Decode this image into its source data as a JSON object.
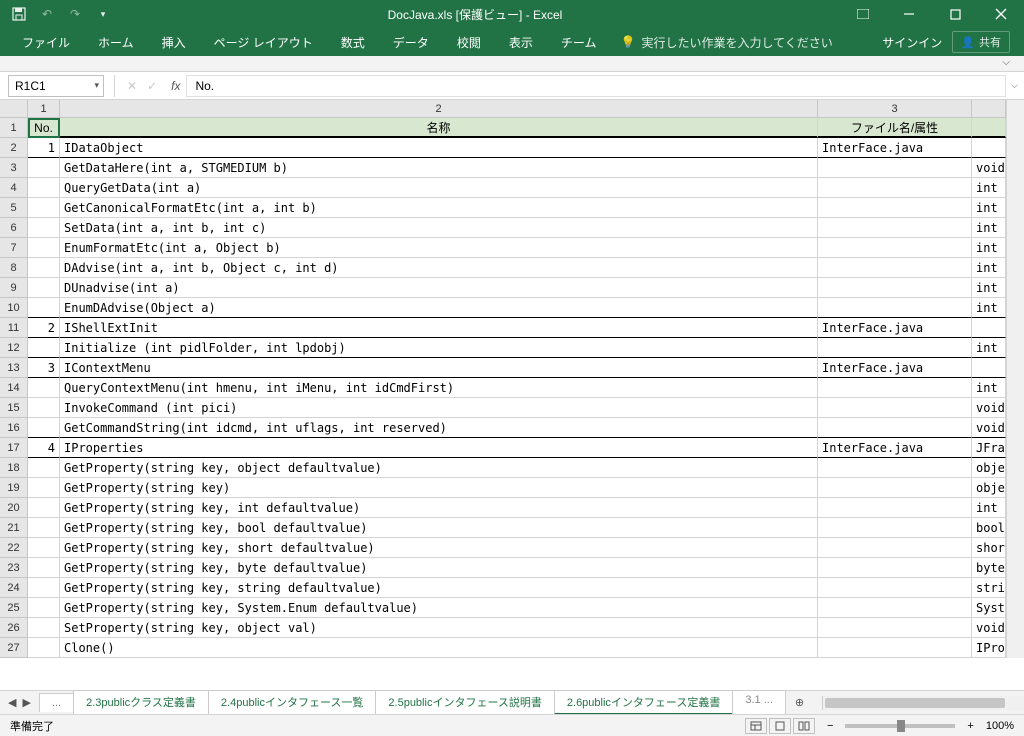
{
  "title": "DocJava.xls  [保護ビュー] - Excel",
  "qat": {
    "undo": "↶",
    "redo": "↷"
  },
  "ribbon": {
    "tabs": [
      "ファイル",
      "ホーム",
      "挿入",
      "ページ レイアウト",
      "数式",
      "データ",
      "校閲",
      "表示",
      "チーム"
    ],
    "tellme": "実行したい作業を入力してください",
    "signin": "サインイン",
    "share": "共有"
  },
  "namebox": "R1C1",
  "formula": "No.",
  "columns": [
    "1",
    "2",
    "3",
    ""
  ],
  "headers": {
    "no": "No.",
    "name": "名称",
    "file": "ファイル名/属性"
  },
  "rows": [
    {
      "r": 2,
      "no": "1",
      "name": "IDataObject",
      "file": "InterFace.java",
      "ret": "",
      "b": true
    },
    {
      "r": 3,
      "no": "",
      "name": "GetDataHere(int a, STGMEDIUM b)",
      "file": "",
      "ret": "void"
    },
    {
      "r": 4,
      "no": "",
      "name": "QueryGetData(int a)",
      "file": "",
      "ret": "int"
    },
    {
      "r": 5,
      "no": "",
      "name": "GetCanonicalFormatEtc(int a, int b)",
      "file": "",
      "ret": "int"
    },
    {
      "r": 6,
      "no": "",
      "name": "SetData(int a, int b, int c)",
      "file": "",
      "ret": "int"
    },
    {
      "r": 7,
      "no": "",
      "name": "EnumFormatEtc(int a, Object b)",
      "file": "",
      "ret": "int"
    },
    {
      "r": 8,
      "no": "",
      "name": "DAdvise(int a, int b, Object c, int d)",
      "file": "",
      "ret": "int"
    },
    {
      "r": 9,
      "no": "",
      "name": "DUnadvise(int a)",
      "file": "",
      "ret": "int"
    },
    {
      "r": 10,
      "no": "",
      "name": "EnumDAdvise(Object a)",
      "file": "",
      "ret": "int",
      "b": true
    },
    {
      "r": 11,
      "no": "2",
      "name": "IShellExtInit",
      "file": "InterFace.java",
      "ret": "",
      "b": true
    },
    {
      "r": 12,
      "no": "",
      "name": "Initialize (int pidlFolder, int lpdobj)",
      "file": "",
      "ret": "int",
      "b": true
    },
    {
      "r": 13,
      "no": "3",
      "name": "IContextMenu",
      "file": "InterFace.java",
      "ret": "",
      "b": true
    },
    {
      "r": 14,
      "no": "",
      "name": "QueryContextMenu(int hmenu, int iMenu, int idCmdFirst)",
      "file": "",
      "ret": "int"
    },
    {
      "r": 15,
      "no": "",
      "name": "InvokeCommand (int pici)",
      "file": "",
      "ret": "void"
    },
    {
      "r": 16,
      "no": "",
      "name": "GetCommandString(int idcmd, int uflags, int reserved)",
      "file": "",
      "ret": "void",
      "b": true
    },
    {
      "r": 17,
      "no": "4",
      "name": "IProperties",
      "file": "InterFace.java",
      "ret": "JFra",
      "b": true
    },
    {
      "r": 18,
      "no": "",
      "name": "GetProperty(string key, object defaultvalue)",
      "file": "",
      "ret": "obje"
    },
    {
      "r": 19,
      "no": "",
      "name": "GetProperty(string key)",
      "file": "",
      "ret": "obje"
    },
    {
      "r": 20,
      "no": "",
      "name": "GetProperty(string key, int defaultvalue)",
      "file": "",
      "ret": "int"
    },
    {
      "r": 21,
      "no": "",
      "name": "GetProperty(string key, bool defaultvalue)",
      "file": "",
      "ret": "bool"
    },
    {
      "r": 22,
      "no": "",
      "name": "GetProperty(string key, short defaultvalue)",
      "file": "",
      "ret": "shor"
    },
    {
      "r": 23,
      "no": "",
      "name": "GetProperty(string key, byte defaultvalue)",
      "file": "",
      "ret": "byte"
    },
    {
      "r": 24,
      "no": "",
      "name": "GetProperty(string key, string defaultvalue)",
      "file": "",
      "ret": "stri"
    },
    {
      "r": 25,
      "no": "",
      "name": "GetProperty(string key, System.Enum defaultvalue)",
      "file": "",
      "ret": "Syst"
    },
    {
      "r": 26,
      "no": "",
      "name": "SetProperty(string key, object val)",
      "file": "",
      "ret": "void"
    },
    {
      "r": 27,
      "no": "",
      "name": "Clone()",
      "file": "",
      "ret": "IPro"
    }
  ],
  "sheets": {
    "prev": "...",
    "tabs": [
      "2.3publicクラス定義書",
      "2.4publicインタフェース一覧",
      "2.5publicインタフェース説明書",
      "2.6publicインタフェース定義書",
      "3.1 ..."
    ],
    "active": 3,
    "add": "⊕"
  },
  "status": {
    "ready": "準備完了",
    "zoom": "100%"
  }
}
